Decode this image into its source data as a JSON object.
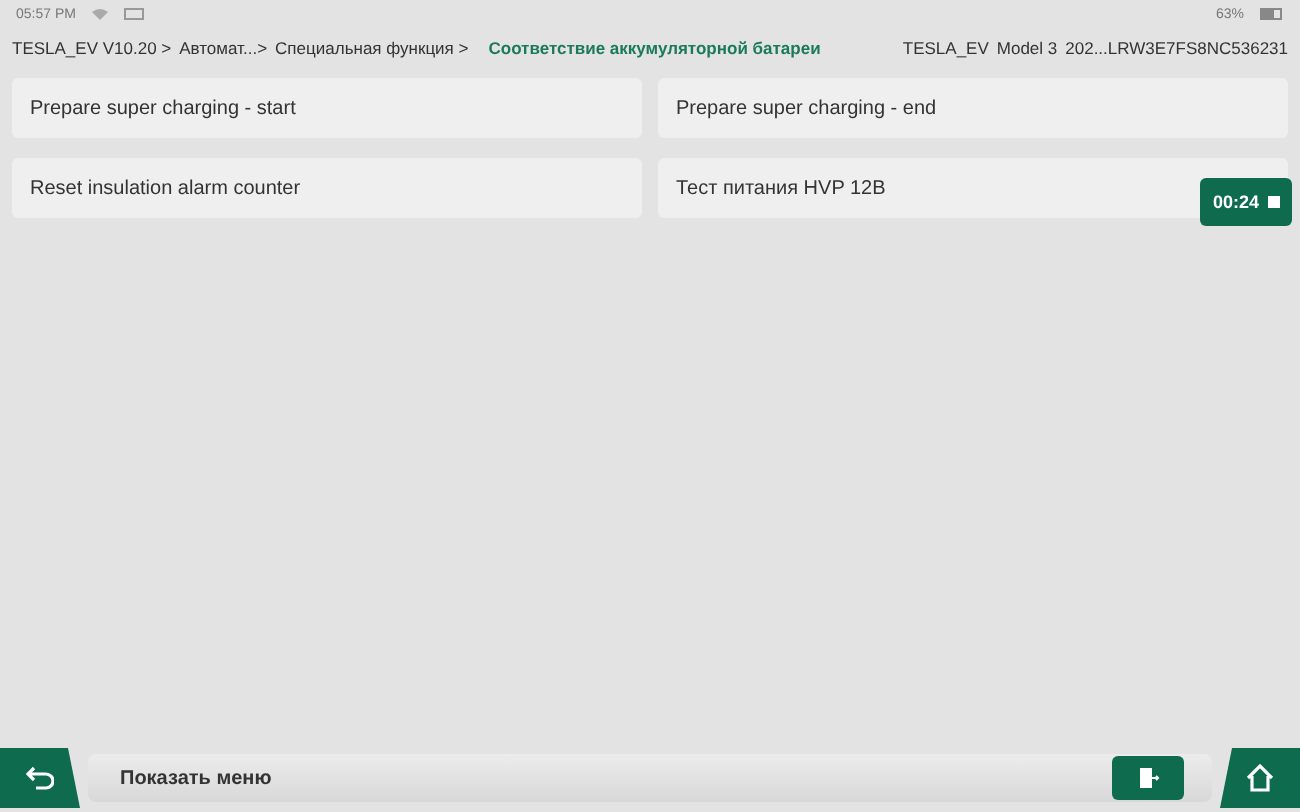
{
  "status_bar": {
    "time": "05:57 PM",
    "battery": "63%"
  },
  "breadcrumb": {
    "items": [
      "TESLA_EV V10.20 >",
      "Автомат...>",
      "Специальная функция >"
    ],
    "current": "Соответствие аккумуляторной батареи",
    "vehicle": [
      "TESLA_EV",
      "Model 3",
      "202...LRW3E7FS8NC536231"
    ]
  },
  "functions": [
    {
      "label": "Prepare super charging - start"
    },
    {
      "label": "Prepare super charging - end"
    },
    {
      "label": "Reset insulation alarm counter"
    },
    {
      "label": "Тест питания HVP 12В"
    }
  ],
  "timer": {
    "time": "00:24"
  },
  "bottom_bar": {
    "menu_label": "Показать меню"
  }
}
